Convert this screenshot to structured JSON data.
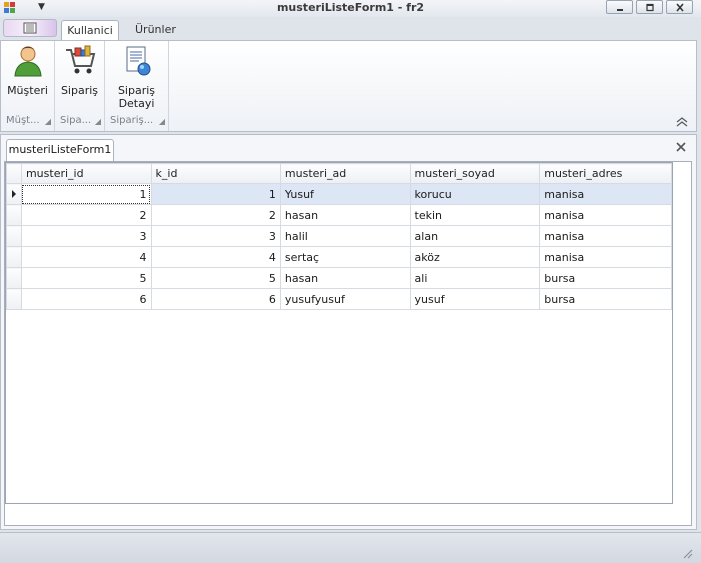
{
  "window": {
    "title": "musteriListeForm1 - fr2"
  },
  "ribbon": {
    "tabs": [
      {
        "label": "Kullanici",
        "active": true
      },
      {
        "label": "Ürünler",
        "active": false
      }
    ],
    "groups": [
      {
        "button_label": "Müşteri",
        "footer": "Müşt...",
        "icon": "user-icon"
      },
      {
        "button_label": "Sipariş",
        "footer": "Sipa...",
        "icon": "cart-icon"
      },
      {
        "button_label": "Sipariş Detayi",
        "button_label_line1": "Sipariş",
        "button_label_line2": "Detayi",
        "footer": "Sipariş...",
        "icon": "document-icon"
      }
    ]
  },
  "document": {
    "tab_label": "musteriListeForm1"
  },
  "grid": {
    "columns": [
      "musteri_id",
      "k_id",
      "musteri_ad",
      "musteri_soyad",
      "musteri_adres"
    ],
    "rows": [
      [
        "1",
        "1",
        "Yusuf",
        "korucu",
        "manisa"
      ],
      [
        "2",
        "2",
        "hasan",
        "tekin",
        "manisa"
      ],
      [
        "3",
        "3",
        "halil",
        "alan",
        "manisa"
      ],
      [
        "4",
        "4",
        "sertaç",
        "aköz",
        "manisa"
      ],
      [
        "5",
        "5",
        "hasan",
        "ali",
        "bursa"
      ],
      [
        "6",
        "6",
        "yusufyusuf",
        "yusuf",
        "bursa"
      ]
    ],
    "selected_row": 0
  },
  "colors": {
    "accent": "#dce6f5",
    "border": "#b7bdc9",
    "background": "#dfe3ea"
  }
}
